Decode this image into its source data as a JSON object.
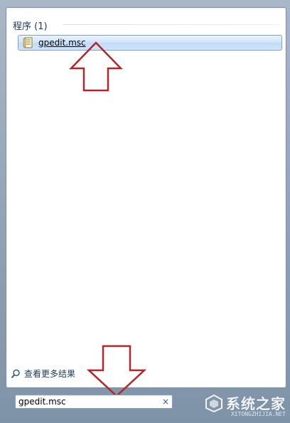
{
  "section": {
    "header": "程序 (1)"
  },
  "results": [
    {
      "label": "gpedit.msc",
      "icon": "msc-file-icon"
    }
  ],
  "see_more": {
    "label": "查看更多结果",
    "icon": "search-icon"
  },
  "search": {
    "value": "gpedit.msc",
    "clear_label": "×"
  },
  "annotations": {
    "arrow_color": "#b0262a"
  },
  "watermark": {
    "title": "系统之家",
    "subtitle": "XITONGZHIJIA.NET"
  }
}
